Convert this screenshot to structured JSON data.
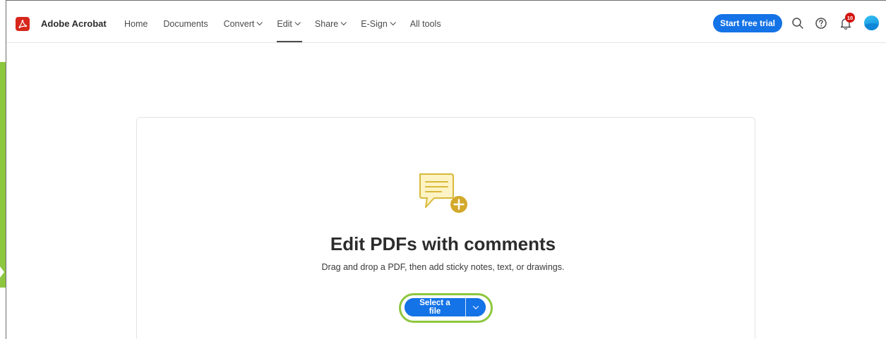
{
  "brand": {
    "name": "Adobe Acrobat",
    "logo_color": "#d7271c"
  },
  "nav": [
    {
      "label": "Home",
      "dropdown": false
    },
    {
      "label": "Documents",
      "dropdown": false
    },
    {
      "label": "Convert",
      "dropdown": true
    },
    {
      "label": "Edit",
      "dropdown": true,
      "active": true
    },
    {
      "label": "Share",
      "dropdown": true
    },
    {
      "label": "E-Sign",
      "dropdown": true
    },
    {
      "label": "All tools",
      "dropdown": false
    }
  ],
  "header": {
    "trial_label": "Start free trial",
    "notification_count": "10",
    "icons": [
      "search-icon",
      "help-icon",
      "bell-icon",
      "avatar"
    ]
  },
  "main": {
    "icon": "comment-add-icon",
    "title": "Edit PDFs with comments",
    "subtitle": "Drag and drop a PDF, then add sticky notes, text, or drawings.",
    "select_label": "Select a file"
  },
  "colors": {
    "accent": "#1473e6",
    "highlight": "#8dc63f",
    "badge": "#d31510",
    "icon_gold": "#d8b93a"
  }
}
